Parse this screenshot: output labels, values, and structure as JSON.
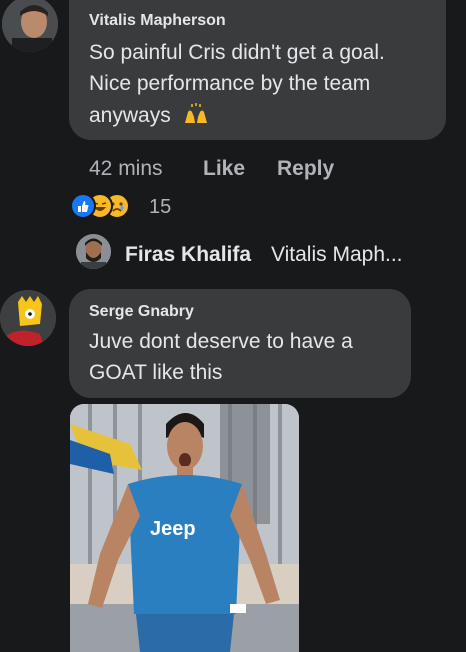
{
  "comments": [
    {
      "author": "Vitalis Mapherson",
      "text_line1": "So painful Cris didn't get a goal.",
      "text_line2": "Nice performance by the team",
      "text_line3": "anyways",
      "time": "42 mins",
      "like_label": "Like",
      "reply_label": "Reply",
      "reaction_count": "15",
      "reply_preview": {
        "author": "Firas Khalifa",
        "text": "Vitalis Maph..."
      }
    },
    {
      "author": "Serge Gnabry",
      "text_line1": "Juve dont deserve to have a",
      "text_line2": "GOAT like this",
      "photo_caption": "Jeep"
    }
  ],
  "colors": {
    "background": "#18191a",
    "bubble": "#3a3b3c",
    "text": "#e4e6eb",
    "muted": "#b0b3b8",
    "like_blue": "#1877f2",
    "haha_yellow": "#f7b928",
    "jersey_blue": "#2a7fc0"
  },
  "icons": [
    "avatar-vitalis",
    "raising-hands-emoji",
    "like-reaction-icon",
    "haha-reaction-icon",
    "sad-reaction-icon",
    "avatar-firas",
    "avatar-serge"
  ]
}
